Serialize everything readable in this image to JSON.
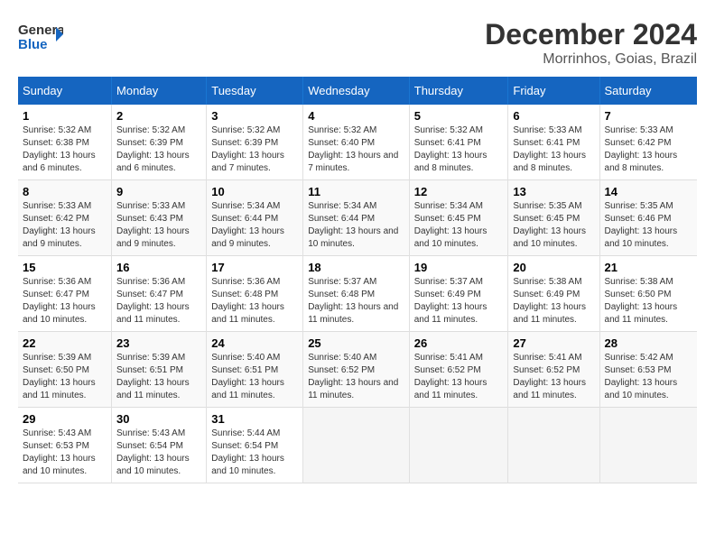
{
  "logo": {
    "line1": "General",
    "line2": "Blue"
  },
  "title": "December 2024",
  "subtitle": "Morrinhos, Goias, Brazil",
  "days_of_week": [
    "Sunday",
    "Monday",
    "Tuesday",
    "Wednesday",
    "Thursday",
    "Friday",
    "Saturday"
  ],
  "weeks": [
    [
      {
        "num": "1",
        "sunrise": "5:32 AM",
        "sunset": "6:38 PM",
        "daylight": "13 hours and 6 minutes."
      },
      {
        "num": "2",
        "sunrise": "5:32 AM",
        "sunset": "6:39 PM",
        "daylight": "13 hours and 6 minutes."
      },
      {
        "num": "3",
        "sunrise": "5:32 AM",
        "sunset": "6:39 PM",
        "daylight": "13 hours and 7 minutes."
      },
      {
        "num": "4",
        "sunrise": "5:32 AM",
        "sunset": "6:40 PM",
        "daylight": "13 hours and 7 minutes."
      },
      {
        "num": "5",
        "sunrise": "5:32 AM",
        "sunset": "6:41 PM",
        "daylight": "13 hours and 8 minutes."
      },
      {
        "num": "6",
        "sunrise": "5:33 AM",
        "sunset": "6:41 PM",
        "daylight": "13 hours and 8 minutes."
      },
      {
        "num": "7",
        "sunrise": "5:33 AM",
        "sunset": "6:42 PM",
        "daylight": "13 hours and 8 minutes."
      }
    ],
    [
      {
        "num": "8",
        "sunrise": "5:33 AM",
        "sunset": "6:42 PM",
        "daylight": "13 hours and 9 minutes."
      },
      {
        "num": "9",
        "sunrise": "5:33 AM",
        "sunset": "6:43 PM",
        "daylight": "13 hours and 9 minutes."
      },
      {
        "num": "10",
        "sunrise": "5:34 AM",
        "sunset": "6:44 PM",
        "daylight": "13 hours and 9 minutes."
      },
      {
        "num": "11",
        "sunrise": "5:34 AM",
        "sunset": "6:44 PM",
        "daylight": "13 hours and 10 minutes."
      },
      {
        "num": "12",
        "sunrise": "5:34 AM",
        "sunset": "6:45 PM",
        "daylight": "13 hours and 10 minutes."
      },
      {
        "num": "13",
        "sunrise": "5:35 AM",
        "sunset": "6:45 PM",
        "daylight": "13 hours and 10 minutes."
      },
      {
        "num": "14",
        "sunrise": "5:35 AM",
        "sunset": "6:46 PM",
        "daylight": "13 hours and 10 minutes."
      }
    ],
    [
      {
        "num": "15",
        "sunrise": "5:36 AM",
        "sunset": "6:47 PM",
        "daylight": "13 hours and 10 minutes."
      },
      {
        "num": "16",
        "sunrise": "5:36 AM",
        "sunset": "6:47 PM",
        "daylight": "13 hours and 11 minutes."
      },
      {
        "num": "17",
        "sunrise": "5:36 AM",
        "sunset": "6:48 PM",
        "daylight": "13 hours and 11 minutes."
      },
      {
        "num": "18",
        "sunrise": "5:37 AM",
        "sunset": "6:48 PM",
        "daylight": "13 hours and 11 minutes."
      },
      {
        "num": "19",
        "sunrise": "5:37 AM",
        "sunset": "6:49 PM",
        "daylight": "13 hours and 11 minutes."
      },
      {
        "num": "20",
        "sunrise": "5:38 AM",
        "sunset": "6:49 PM",
        "daylight": "13 hours and 11 minutes."
      },
      {
        "num": "21",
        "sunrise": "5:38 AM",
        "sunset": "6:50 PM",
        "daylight": "13 hours and 11 minutes."
      }
    ],
    [
      {
        "num": "22",
        "sunrise": "5:39 AM",
        "sunset": "6:50 PM",
        "daylight": "13 hours and 11 minutes."
      },
      {
        "num": "23",
        "sunrise": "5:39 AM",
        "sunset": "6:51 PM",
        "daylight": "13 hours and 11 minutes."
      },
      {
        "num": "24",
        "sunrise": "5:40 AM",
        "sunset": "6:51 PM",
        "daylight": "13 hours and 11 minutes."
      },
      {
        "num": "25",
        "sunrise": "5:40 AM",
        "sunset": "6:52 PM",
        "daylight": "13 hours and 11 minutes."
      },
      {
        "num": "26",
        "sunrise": "5:41 AM",
        "sunset": "6:52 PM",
        "daylight": "13 hours and 11 minutes."
      },
      {
        "num": "27",
        "sunrise": "5:41 AM",
        "sunset": "6:52 PM",
        "daylight": "13 hours and 11 minutes."
      },
      {
        "num": "28",
        "sunrise": "5:42 AM",
        "sunset": "6:53 PM",
        "daylight": "13 hours and 10 minutes."
      }
    ],
    [
      {
        "num": "29",
        "sunrise": "5:43 AM",
        "sunset": "6:53 PM",
        "daylight": "13 hours and 10 minutes."
      },
      {
        "num": "30",
        "sunrise": "5:43 AM",
        "sunset": "6:54 PM",
        "daylight": "13 hours and 10 minutes."
      },
      {
        "num": "31",
        "sunrise": "5:44 AM",
        "sunset": "6:54 PM",
        "daylight": "13 hours and 10 minutes."
      },
      null,
      null,
      null,
      null
    ]
  ],
  "labels": {
    "sunrise": "Sunrise:",
    "sunset": "Sunset:",
    "daylight": "Daylight:"
  }
}
